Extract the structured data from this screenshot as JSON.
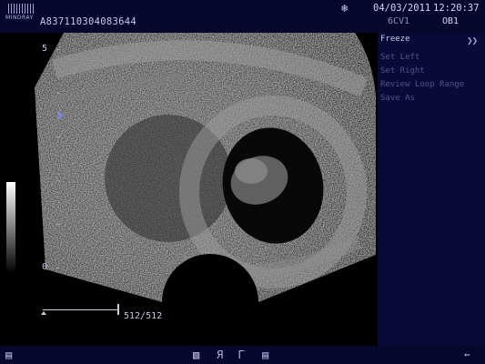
{
  "header": {
    "brand": "MINDRAY",
    "patient_id": "A837110304083644",
    "date": "04/03/2011",
    "time": "12:20:37",
    "probe": "6CV1",
    "exam": "OB1"
  },
  "depth_scale": {
    "top": "5",
    "bottom": "0"
  },
  "cine": {
    "frame_counter": "512/512"
  },
  "menu": {
    "freeze": "Freeze",
    "items": [
      "Set Left",
      "Set Right",
      "Review Loop Range",
      "Save As"
    ]
  },
  "icons": {
    "snowflake": "freeze-snowflake-icon",
    "expand": "double-chevron-right-icon",
    "footer": [
      "monitor-icon",
      "settings-icon",
      "reverse-r-icon",
      "reverse-r-icon",
      "document-icon",
      "usb-icon"
    ]
  },
  "colors": {
    "bar": "#07072e",
    "panel": "#0a0a38",
    "text": "#c8cbe8",
    "dim": "#4f5386"
  }
}
